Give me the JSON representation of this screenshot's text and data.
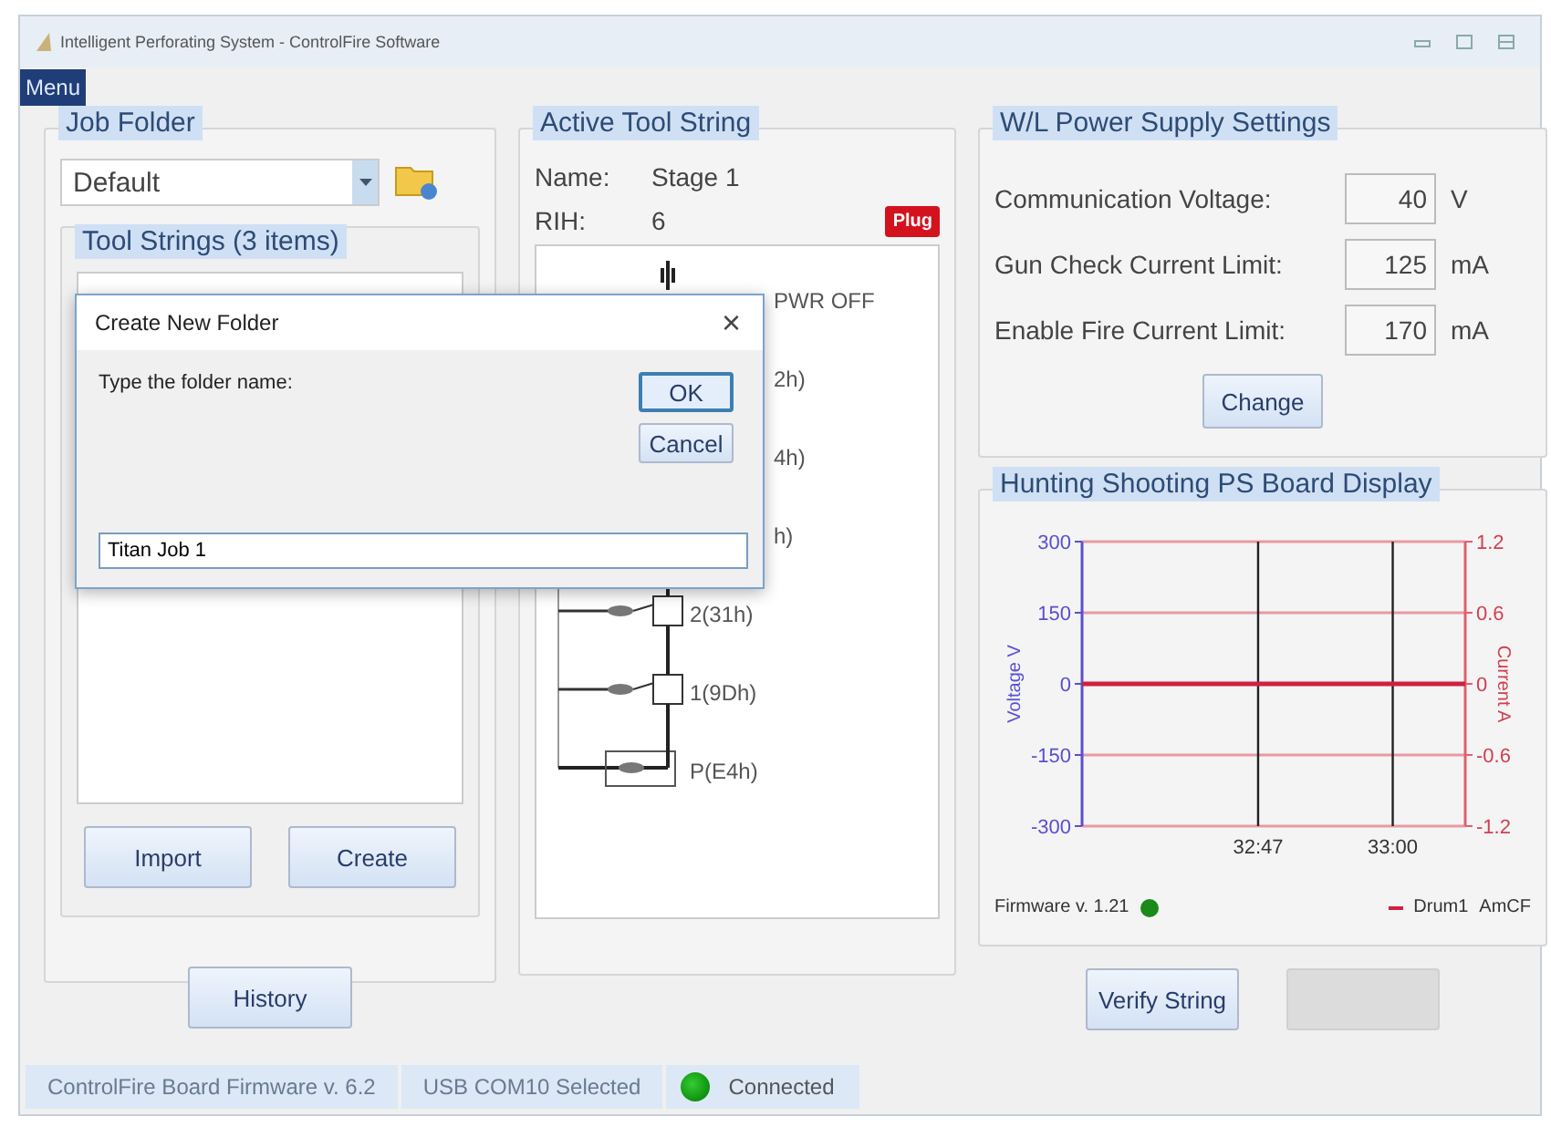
{
  "window": {
    "title": "Intelligent Perforating System - ControlFire Software"
  },
  "menu": [
    {
      "label": "Menu",
      "selected": true
    }
  ],
  "job_folder": {
    "title": "Job Folder",
    "folder": "Default",
    "tool_strings": {
      "title": "Tool Strings (3 items)"
    },
    "buttons": [
      {
        "label": "Import"
      },
      {
        "label": "Create"
      }
    ],
    "history_button": "History"
  },
  "active_tool_string": {
    "title": "Active Tool String",
    "name_label": "Name:",
    "name": "Stage 1",
    "rih_label": "RIH:",
    "rih": "6",
    "badge": "Plug",
    "items": [
      {
        "kind": "switch",
        "label": "PWR OFF"
      },
      {
        "kind": "covered",
        "label": "2h)"
      },
      {
        "kind": "covered",
        "label": "4h)"
      },
      {
        "kind": "covered",
        "label": "h)"
      },
      {
        "kind": "gun",
        "label": "2(31h)"
      },
      {
        "kind": "gun",
        "label": "1(9Dh)"
      },
      {
        "kind": "plug",
        "label": "P(E4h)"
      }
    ]
  },
  "power_supply": {
    "title": "W/L Power Supply Settings",
    "fields": [
      {
        "label": "Communication Voltage:",
        "value": "40",
        "unit": "V"
      },
      {
        "label": "Gun Check Current Limit:",
        "value": "125",
        "unit": "mA"
      },
      {
        "label": "Enable Fire Current Limit:",
        "value": "170",
        "unit": "mA"
      }
    ],
    "button": "Change"
  },
  "ps_board": {
    "title": "Hunting Shooting PS Board Display",
    "chart_data": {
      "type": "line",
      "grid": true,
      "ylabel": "Voltage V",
      "x": [
        1950,
        1987
      ],
      "xlim": [
        1950,
        1987
      ],
      "xticks": [
        {
          "value": 1967,
          "label": "32:47"
        },
        {
          "value": 1980,
          "label": "33:00"
        }
      ],
      "ylim": [
        -300,
        300
      ],
      "yticks": [
        -300,
        -150,
        0,
        150,
        300
      ],
      "series": [
        {
          "name": "Drum1",
          "color": "#d02040",
          "values": [
            0,
            0
          ]
        }
      ]
    },
    "right_axis": {
      "label": "Current A",
      "ticks": [
        "1.2",
        "0.6",
        "0",
        "-0.6",
        "-1.2"
      ]
    },
    "firmware": "Firmware v. 1.21",
    "firmware_ok": true,
    "legend_extra": "AmCF"
  },
  "actions": [
    {
      "label": "Verify String",
      "disabled": false
    },
    {
      "disabled": true
    }
  ],
  "status_bar": {
    "segments": [
      "ControlFire Board Firmware v. 6.2",
      "USB COM10 Selected"
    ],
    "connected": true,
    "connection": "Connected"
  },
  "dialog": {
    "title": "Create New Folder",
    "close": "×",
    "prompt": "Type the folder name:",
    "value": "Titan Job 1",
    "buttons": [
      {
        "label": "OK",
        "default": true
      },
      {
        "label": "Cancel",
        "default": false
      }
    ]
  }
}
